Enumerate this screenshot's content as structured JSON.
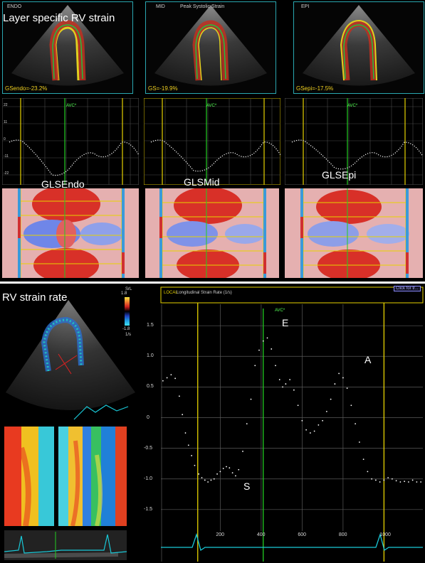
{
  "top": {
    "title": "Layer specific RV strain",
    "panels": [
      {
        "layer": "ENDO",
        "subtitle": "",
        "gs_value": "GSendo=-23.2%",
        "curve_label": "GLSEndo"
      },
      {
        "layer": "MID",
        "subtitle": "Peak Systolic Strain",
        "gs_value": "GS=-19.9%",
        "curve_label": "GLSMid"
      },
      {
        "layer": "EPI",
        "subtitle": "",
        "gs_value": "GSepi=-17.5%",
        "curve_label": "GLSEpi"
      }
    ],
    "strain_axis_ticks": [
      "22",
      "11",
      "0",
      "-11",
      "-22"
    ],
    "avc_label": "AVC*"
  },
  "bottom": {
    "title": "RV strain rate",
    "scale": {
      "unit_short": "SrL",
      "max": "1.8",
      "min": "-1.8",
      "unit": "1/s"
    },
    "chart_header": "Longitudinal Strain Rate (1/s)",
    "chart_header_prefix": "LOCAL:",
    "click_hint": "Click for tr...",
    "avc_label": "AVC*",
    "peak_labels": {
      "s": "S",
      "e": "E",
      "a": "A"
    }
  },
  "colors": {
    "panel_border": "#2aa7b0",
    "ecg": "#19c9d8",
    "marker_yellow": "#e6d200",
    "avc_green": "#22cc22"
  },
  "chart_data": {
    "type": "scatter",
    "title": "Longitudinal Strain Rate (1/s)",
    "xlabel": "",
    "ylabel": "",
    "x_ticks": [
      "200",
      "400",
      "600",
      "800",
      "1000"
    ],
    "y_ticks": [
      "1.5",
      "1.0",
      "0.5",
      "0",
      "-0.5",
      "-1.0",
      "-1.5"
    ],
    "xlim": [
      -90,
      1190
    ],
    "ylim": [
      -1.85,
      1.85
    ],
    "markers": {
      "yellow_x": [
        90,
        1000
      ],
      "avc_x": 410
    },
    "series": [
      {
        "x": [
          -80,
          -60,
          -40,
          -20,
          0,
          15,
          30,
          45,
          60,
          75,
          95,
          110,
          125,
          140,
          155,
          170,
          185,
          200,
          215,
          230,
          245,
          260,
          275,
          290,
          310,
          330,
          350,
          370,
          390,
          410,
          430,
          450,
          470,
          490,
          505,
          520,
          540,
          560,
          580,
          600,
          620,
          640,
          660,
          680,
          700,
          720,
          740,
          760,
          780,
          800,
          820,
          840,
          860,
          880,
          900,
          920,
          940,
          960,
          980,
          1000,
          1020,
          1040,
          1060,
          1080,
          1100,
          1120,
          1140,
          1160,
          1180
        ],
        "y": [
          0.6,
          0.65,
          0.7,
          0.64,
          0.35,
          0.05,
          -0.25,
          -0.45,
          -0.62,
          -0.78,
          -0.92,
          -0.98,
          -1.02,
          -1.05,
          -1.02,
          -1.0,
          -0.92,
          -0.88,
          -0.83,
          -0.8,
          -0.82,
          -0.9,
          -0.95,
          -0.85,
          -0.55,
          -0.1,
          0.3,
          0.85,
          1.1,
          1.25,
          1.3,
          1.12,
          0.85,
          0.62,
          0.5,
          0.55,
          0.62,
          0.45,
          0.2,
          -0.05,
          -0.2,
          -0.25,
          -0.22,
          -0.12,
          -0.05,
          0.1,
          0.3,
          0.55,
          0.72,
          0.65,
          0.48,
          0.2,
          -0.1,
          -0.4,
          -0.68,
          -0.88,
          -1.0,
          -1.02,
          -1.05,
          -1.02,
          -0.98,
          -1.0,
          -1.03,
          -1.05,
          -1.04,
          -1.05,
          -1.02,
          -1.05,
          -1.05
        ]
      }
    ]
  }
}
